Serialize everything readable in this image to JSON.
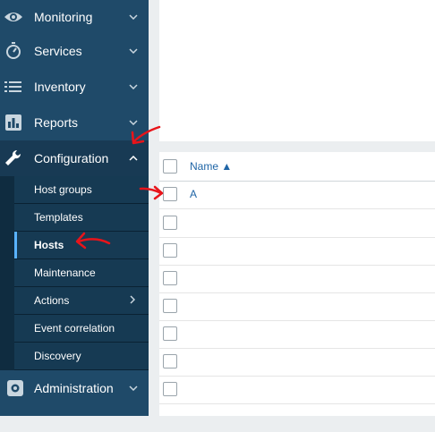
{
  "sidebar": {
    "items": [
      {
        "label": "Monitoring",
        "icon": "eye-icon"
      },
      {
        "label": "Services",
        "icon": "stopwatch-icon"
      },
      {
        "label": "Inventory",
        "icon": "list-icon"
      },
      {
        "label": "Reports",
        "icon": "bar-chart-icon"
      },
      {
        "label": "Configuration",
        "icon": "wrench-icon"
      },
      {
        "label": "Administration",
        "icon": "gear-icon"
      }
    ],
    "submenu": [
      {
        "label": "Host groups"
      },
      {
        "label": "Templates"
      },
      {
        "label": "Hosts"
      },
      {
        "label": "Maintenance"
      },
      {
        "label": "Actions"
      },
      {
        "label": "Event correlation"
      },
      {
        "label": "Discovery"
      }
    ]
  },
  "table": {
    "header_name": "Name ▲",
    "first_row_name": "A"
  },
  "colors": {
    "sidebar": "#1f4a69",
    "active": "#183a54",
    "link": "#1f65a6",
    "annotation": "#e8141a"
  }
}
